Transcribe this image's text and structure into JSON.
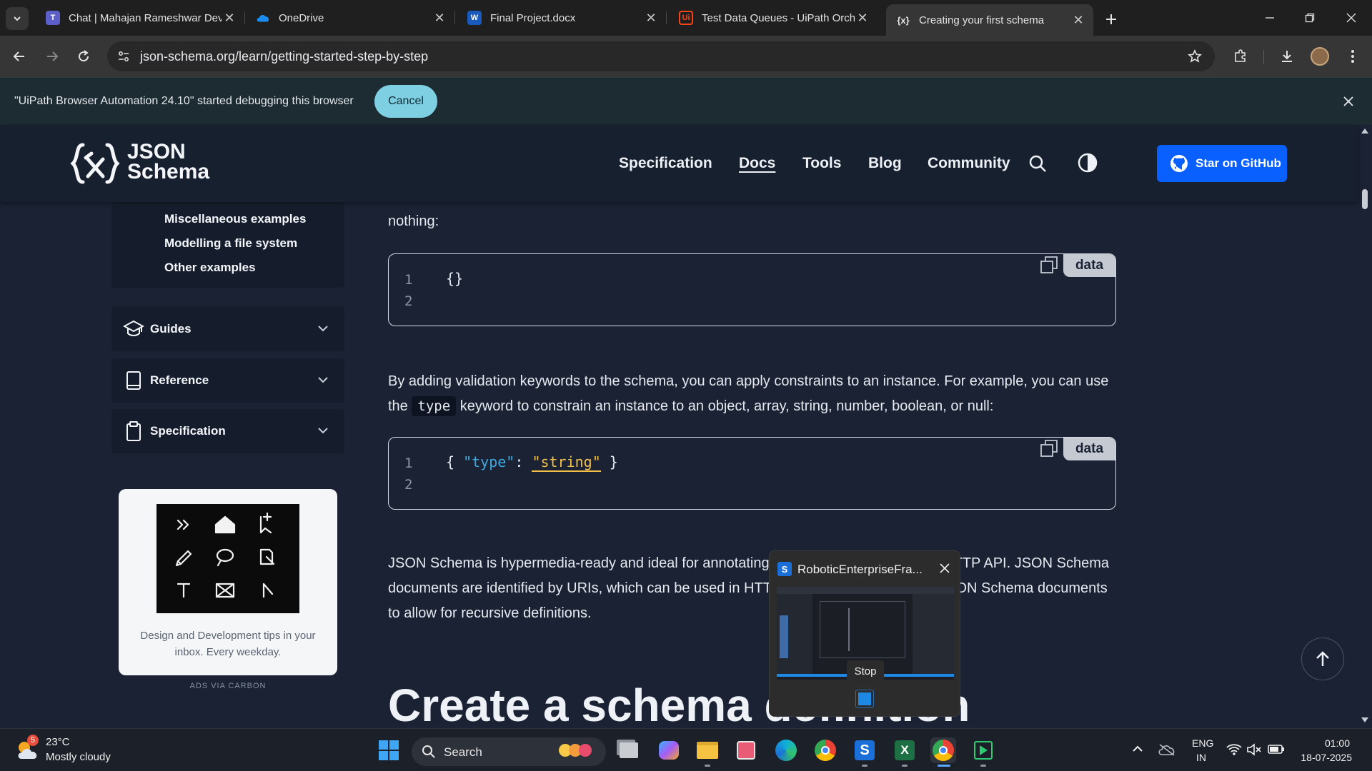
{
  "browser": {
    "tabs": [
      {
        "title": "Chat | Mahajan Rameshwar Dev",
        "icon": "teams-icon",
        "color": "#5b5fc7"
      },
      {
        "title": "OneDrive",
        "icon": "onedrive-icon",
        "color": "#0f78d4"
      },
      {
        "title": "Final Project.docx",
        "icon": "word-icon",
        "color": "#185abd"
      },
      {
        "title": "Test Data Queues - UiPath Orch",
        "icon": "uipath-icon",
        "color": "#fa4616"
      },
      {
        "title": "Creating your first schema",
        "icon": "json-schema-icon",
        "active": true
      }
    ],
    "url": "json-schema.org/learn/getting-started-step-by-step",
    "infobar": {
      "text": "\"UiPath Browser Automation 24.10\" started debugging this browser",
      "cancel_label": "Cancel"
    }
  },
  "site": {
    "logo": {
      "line1": "JSON",
      "line2": "Schema"
    },
    "nav": [
      "Specification",
      "Docs",
      "Tools",
      "Blog",
      "Community"
    ],
    "active_nav": "Docs",
    "github_label": "Star on GitHub"
  },
  "sidebar": {
    "links": [
      "Miscellaneous examples",
      "Modelling a file system",
      "Other examples"
    ],
    "sections": [
      {
        "label": "Guides",
        "icon": "graduation-cap-icon"
      },
      {
        "label": "Reference",
        "icon": "book-icon"
      },
      {
        "label": "Specification",
        "icon": "clipboard-icon"
      }
    ],
    "ad": {
      "text": "Design and Development tips in your inbox. Every weekday.",
      "via": "ADS VIA CARBON"
    }
  },
  "main": {
    "para0_tail": "nothing:",
    "code1": {
      "lines": [
        "1",
        "2"
      ],
      "code": "{}",
      "tag": "data"
    },
    "para1": {
      "before": "By adding validation keywords to the schema, you can apply constraints to an instance. For example, you can use the",
      "code": "type",
      "after": "keyword to constrain an instance to an object, array, string, number, boolean, or null:"
    },
    "code2": {
      "lines": [
        "1",
        "2"
      ],
      "key": "\"type\"",
      "value": "\"string\"",
      "tag": "data"
    },
    "para2": "JSON Schema is hypermedia-ready and ideal for annotating your existing JSON-based HTTP API. JSON Schema documents are identified by URIs, which can be used in HTTP Link headers and within JSON Schema documents to allow for recursive definitions.",
    "heading": "Create a schema definition"
  },
  "preview": {
    "title": "RoboticEnterpriseFra...",
    "stop_label": "Stop"
  },
  "taskbar": {
    "weather": {
      "temp": "23°C",
      "desc": "Mostly cloudy",
      "badge": "5"
    },
    "search_label": "Search",
    "lang_top": "ENG",
    "lang_bottom": "IN",
    "time": "01:00",
    "date": "18-07-2025"
  }
}
